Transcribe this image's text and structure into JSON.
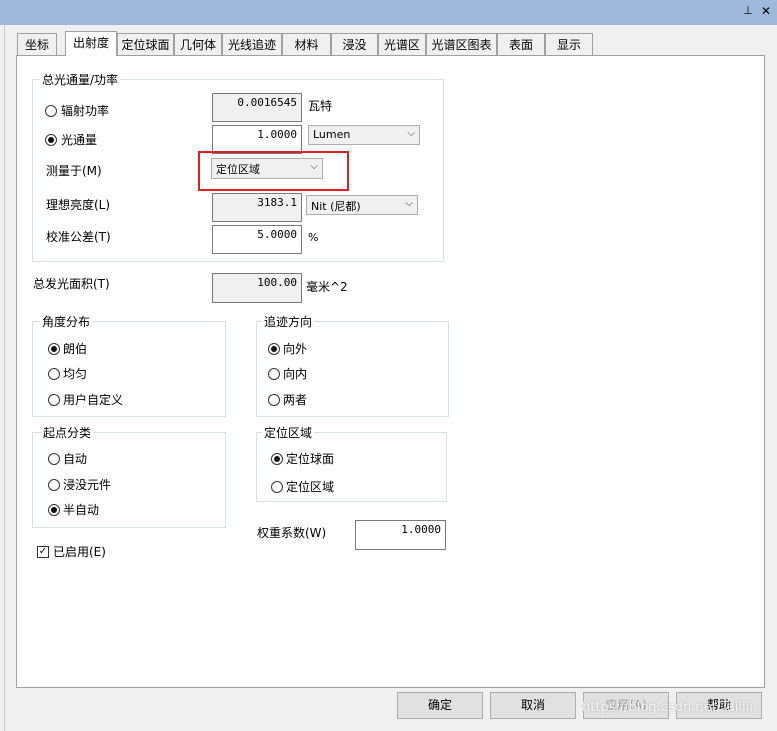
{
  "window": {
    "pin_icon": "pin-icon",
    "close_icon": "close-icon"
  },
  "tabs": [
    {
      "label": "坐标",
      "active": false
    },
    {
      "label": "出射度",
      "active": true
    },
    {
      "label": "定位球面",
      "active": false
    },
    {
      "label": "几何体",
      "active": false
    },
    {
      "label": "光线追迹",
      "active": false
    },
    {
      "label": "材料",
      "active": false
    },
    {
      "label": "浸没",
      "active": false
    },
    {
      "label": "光谱区",
      "active": false
    },
    {
      "label": "光谱区图表",
      "active": false
    },
    {
      "label": "表面",
      "active": false
    },
    {
      "label": "显示",
      "active": false
    }
  ],
  "total_flux": {
    "title": "总光通量/功率",
    "radiant_power": {
      "label": "辐射功率",
      "selected": false,
      "value": "0.0016545",
      "unit": "瓦特"
    },
    "luminous_flux": {
      "label": "光通量",
      "selected": true,
      "value": "1.0000",
      "unit": "Lumen"
    },
    "measured_at": {
      "label": "测量于(M)",
      "value": "定位区域"
    },
    "ideal_luminance": {
      "label": "理想亮度(L)",
      "value": "3183.1",
      "unit": "Nit (尼都)"
    },
    "calibration_tolerance": {
      "label": "校准公差(T)",
      "value": "5.0000",
      "unit": "%"
    }
  },
  "total_emitting_area": {
    "label": "总发光面积(T)",
    "value": "100.00",
    "unit": "毫米^2"
  },
  "angular_distribution": {
    "title": "角度分布",
    "options": [
      {
        "label": "朗伯",
        "selected": true
      },
      {
        "label": "均匀",
        "selected": false
      },
      {
        "label": "用户自定义",
        "selected": false
      }
    ]
  },
  "trace_direction": {
    "title": "追迹方向",
    "options": [
      {
        "label": "向外",
        "selected": true
      },
      {
        "label": "向内",
        "selected": false
      },
      {
        "label": "两者",
        "selected": false
      }
    ]
  },
  "start_classification": {
    "title": "起点分类",
    "options": [
      {
        "label": "自动",
        "selected": false
      },
      {
        "label": "浸没元件",
        "selected": false
      },
      {
        "label": "半自动",
        "selected": true
      }
    ]
  },
  "location_area": {
    "title": "定位区域",
    "options": [
      {
        "label": "定位球面",
        "selected": true
      },
      {
        "label": "定位区域",
        "selected": false
      }
    ]
  },
  "weight_factor": {
    "label": "权重系数(W)",
    "value": "1.0000"
  },
  "enabled": {
    "label": "已启用(E)",
    "checked": true
  },
  "buttons": {
    "ok": "确定",
    "cancel": "取消",
    "apply": "应用(A)",
    "help": "帮助"
  },
  "watermark": "https://blog.csdn.net/Taiiiii"
}
